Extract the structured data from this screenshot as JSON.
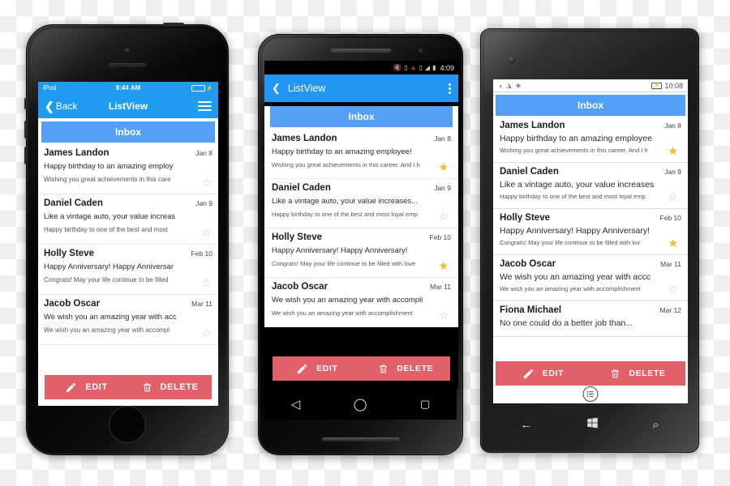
{
  "scene": {
    "title": "Cross-platform ListView mail app mockup on three phones"
  },
  "messages": {
    "james": {
      "name": "James Landon",
      "date": "Jan 8",
      "subject": "Happy birthday to an amazing employee!",
      "preview": "Wishing you great achievements in this career, And I h",
      "starred": true
    },
    "daniel": {
      "name": "Daniel Caden",
      "date": "Jan 9",
      "subject": "Like a vintage auto, your value increases...",
      "preview": "Happy birthday to one of the best and most loyal emp",
      "starred": false
    },
    "holly": {
      "name": "Holly Steve",
      "date": "Feb 10",
      "subject": "Happy Anniversary! Happy Anniversary!",
      "preview": "Congrats! May your life continue to be filled with love",
      "starred": true
    },
    "jacob": {
      "name": "Jacob Oscar",
      "date": "Mar 11",
      "subject": "We wish you an amazing year with accomplis",
      "preview": "We wish you an amazing year with accomplishment",
      "starred": false
    },
    "fiona": {
      "name": "Fiona Michael",
      "date": "Mar 12",
      "subject": "No one could do a better job than...",
      "preview": "",
      "starred": false
    }
  },
  "shared": {
    "inbox_label": "Inbox",
    "edit_label": "EDIT",
    "delete_label": "DELETE",
    "star_on": "★",
    "star_off": "☆",
    "accent_blue": "#2196f3",
    "inbox_blue": "#55a0f7",
    "action_red": "#e2606a",
    "star_gold": "#f6b81c"
  },
  "iphone": {
    "status": {
      "carrier": "iPod",
      "clock": "9:44 AM",
      "battery_bolt": "⚡"
    },
    "nav": {
      "back_label": "Back",
      "back_chevron": "❮",
      "title": "ListView"
    },
    "list": [
      {
        "name": "James Landon",
        "date": "Jan 8",
        "subject": "Happy birthday to an amazing employ",
        "preview": "Wishing you great achievements in this care",
        "star": "☆"
      },
      {
        "name": "Daniel Caden",
        "date": "Jan 9",
        "subject": "Like a vintage auto, your value increas",
        "preview": "Happy birthday to one of the best and most",
        "star": "☆"
      },
      {
        "name": "Holly Steve",
        "date": "Feb 10",
        "subject": "Happy Anniversary! Happy Anniversar",
        "preview": "Congrats! May your life continue to be filled",
        "star": "☆"
      },
      {
        "name": "Jacob Oscar",
        "date": "Mar 11",
        "subject": "We wish you an amazing year with acc",
        "preview": "We wish you an amazing year with accompl",
        "star": "☆"
      }
    ]
  },
  "android": {
    "status": {
      "clock": "4:09"
    },
    "appbar": {
      "back_chevron": "❮",
      "title": "ListView"
    },
    "list": [
      {
        "name": "James Landon",
        "date": "Jan 8",
        "subject": "Happy birthday to an amazing employee!",
        "preview": "Wishing you great achievements in this career, And I h",
        "star": "★",
        "starred": true
      },
      {
        "name": "Daniel Caden",
        "date": "Jan 9",
        "subject": "Like a vintage auto, your value increases...",
        "preview": "Happy birthday to one of the best and most loyal emp",
        "star": "☆",
        "starred": false
      },
      {
        "name": "Holly Steve",
        "date": "Feb 10",
        "subject": "Happy Anniversary! Happy Anniversary!",
        "preview": "Congrats! May your life continue to be filled with love",
        "star": "★",
        "starred": true
      },
      {
        "name": "Jacob Oscar",
        "date": "Mar 11",
        "subject": "We wish you an amazing year with accompli",
        "preview": "We wish you an amazing year with accomplishment",
        "star": "☆",
        "starred": false
      }
    ],
    "navbar": {
      "back": "◁",
      "home": "◯",
      "recents": "▢"
    }
  },
  "windows": {
    "status": {
      "clock": "10:08"
    },
    "list": [
      {
        "name": "James Landon",
        "date": "Jan 8",
        "subject": "Happy birthday to an amazing employee",
        "preview": "Wishing you great achievements in this career, And I h",
        "star": "★",
        "starred": true
      },
      {
        "name": "Daniel Caden",
        "date": "Jan 9",
        "subject": "Like a vintage auto, your value increases",
        "preview": "Happy birthday to one of the best and most loyal emp",
        "star": "☆",
        "starred": false
      },
      {
        "name": "Holly Steve",
        "date": "Feb 10",
        "subject": "Happy Anniversary! Happy Anniversary!",
        "preview": "Congrats! May your life continue to be filled with lov",
        "star": "★",
        "starred": true
      },
      {
        "name": "Jacob Oscar",
        "date": "Mar 11",
        "subject": "We wish you an amazing year with accc",
        "preview": "We wish you an amazing year with accomplishment",
        "star": "☆",
        "starred": false
      },
      {
        "name": "Fiona Michael",
        "date": "Mar 12",
        "subject": "No one could do a better job than...",
        "preview": "",
        "star": "",
        "starred": false
      }
    ],
    "navbar": {
      "back": "←",
      "search": "⌕"
    }
  }
}
